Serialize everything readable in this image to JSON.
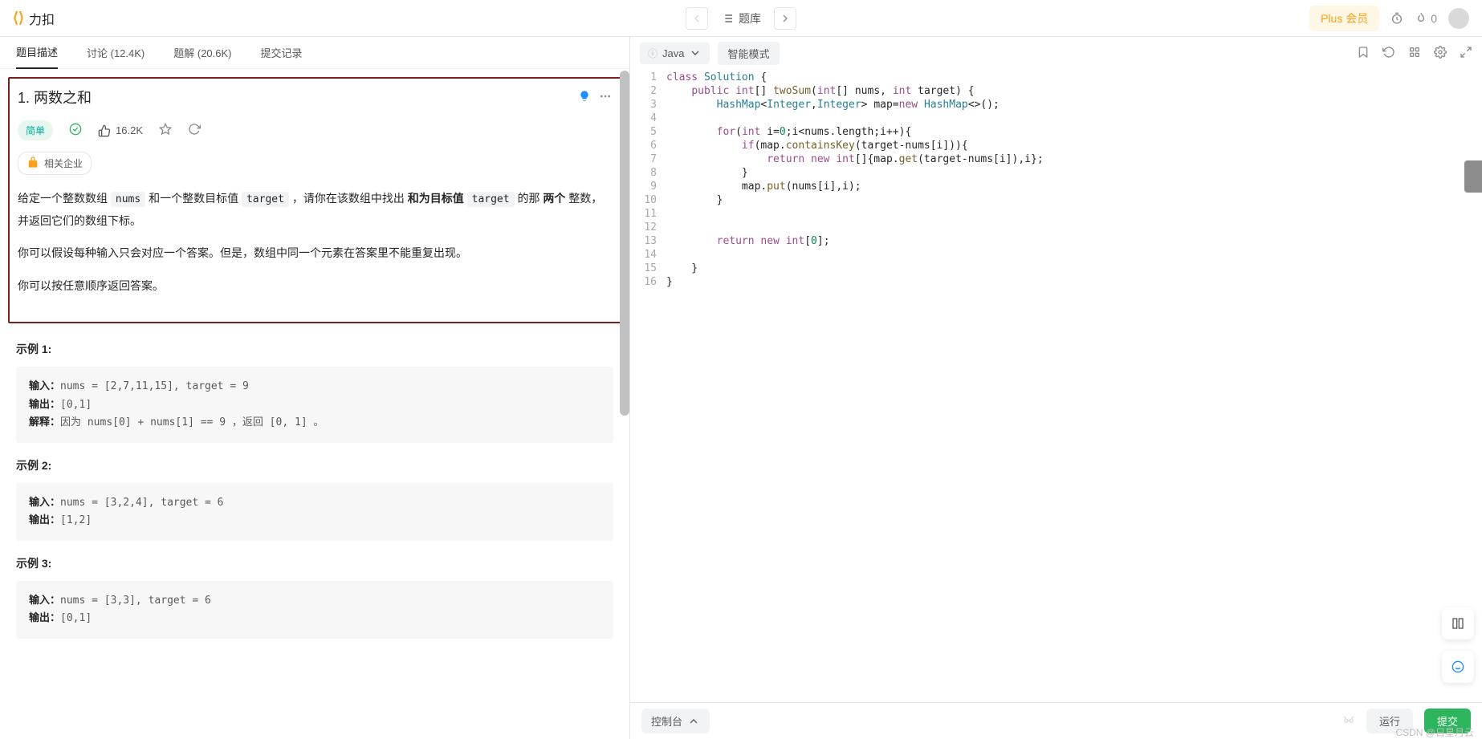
{
  "header": {
    "logo_text": "力扣",
    "problem_list_label": "题库",
    "plus_label": "Plus 会员",
    "streak_count": "0"
  },
  "left": {
    "tabs": {
      "description": "题目描述",
      "discuss": "讨论 (12.4K)",
      "solutions": "题解 (20.6K)",
      "submissions": "提交记录"
    },
    "title": "1. 两数之和",
    "difficulty": "简单",
    "likes": "16.2K",
    "companies": "相关企业",
    "desc_p1_a": "给定一个整数数组 ",
    "desc_p1_nums": "nums",
    "desc_p1_b": " 和一个整数目标值 ",
    "desc_p1_target": "target",
    "desc_p1_c": " ，请你在该数组中找出 ",
    "desc_p1_bold1": "和为目标值",
    "desc_p1_d": " ",
    "desc_p1_target2": "target",
    "desc_p1_e": " 的那 ",
    "desc_p1_bold2": "两个",
    "desc_p1_f": " 整数，并返回它们的数组下标。",
    "desc_p2": "你可以假设每种输入只会对应一个答案。但是，数组中同一个元素在答案里不能重复出现。",
    "desc_p3": "你可以按任意顺序返回答案。",
    "examples": [
      {
        "title": "示例 1:",
        "input_label": "输入：",
        "input": "nums = [2,7,11,15], target = 9",
        "output_label": "输出：",
        "output": "[0,1]",
        "explain_label": "解释：",
        "explain": "因为 nums[0] + nums[1] == 9 ，返回 [0, 1] 。"
      },
      {
        "title": "示例 2:",
        "input_label": "输入：",
        "input": "nums = [3,2,4], target = 6",
        "output_label": "输出：",
        "output": "[1,2]"
      },
      {
        "title": "示例 3:",
        "input_label": "输入：",
        "input": "nums = [3,3], target = 6",
        "output_label": "输出：",
        "output": "[0,1]"
      }
    ]
  },
  "right": {
    "language": "Java",
    "smart_mode": "智能模式",
    "code_lines": [
      "class Solution {",
      "    public int[] twoSum(int[] nums, int target) {",
      "        HashMap<Integer,Integer> map=new HashMap<>();",
      "",
      "        for(int i=0;i<nums.length;i++){",
      "            if(map.containsKey(target-nums[i])){",
      "                return new int[]{map.get(target-nums[i]),i};",
      "            }",
      "            map.put(nums[i],i);",
      "        }",
      "",
      "",
      "        return new int[0];",
      "",
      "    }",
      "}"
    ],
    "console": "控制台",
    "run": "运行",
    "submit": "提交"
  },
  "watermark": "CSDN @日星月云"
}
